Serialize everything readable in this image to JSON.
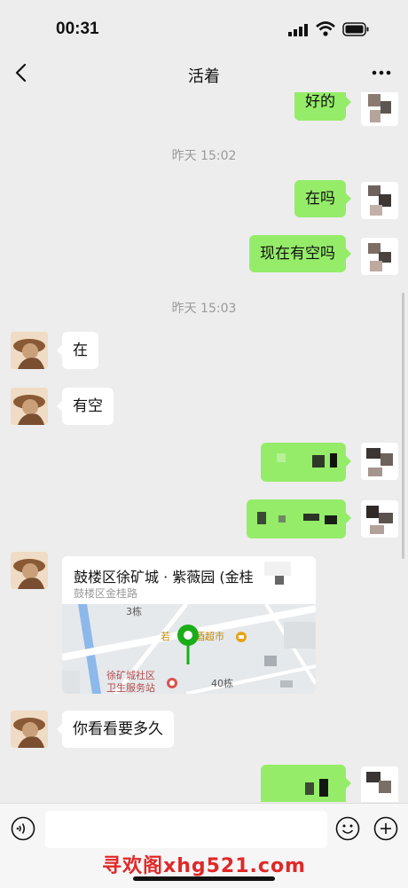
{
  "status_bar": {
    "time": "00:31"
  },
  "nav": {
    "title": "活着"
  },
  "messages": {
    "m1": "好的",
    "ts1": "昨天 15:02",
    "m2": "在吗",
    "m3": "现在有空吗",
    "ts2": "昨天 15:03",
    "m4": "在",
    "m5": "有空",
    "m8": "你看看要多久"
  },
  "location": {
    "title": "鼓楼区徐矿城 · 紫薇园 (金桂",
    "address": "鼓楼区金桂路",
    "map_labels": [
      "3栋",
      "若",
      "酒超市",
      "徐矿城社区",
      "卫生服务站",
      "40栋"
    ]
  },
  "input_bar": {
    "placeholder": ""
  },
  "watermark": "寻欢阁xhg521.com",
  "colors": {
    "me_bubble": "#95ec69",
    "other_bubble": "#ffffff",
    "background": "#ededed"
  },
  "icons": [
    "back-icon",
    "more-icon",
    "voice-icon",
    "emoji-icon",
    "plus-icon",
    "location-pin-icon"
  ]
}
